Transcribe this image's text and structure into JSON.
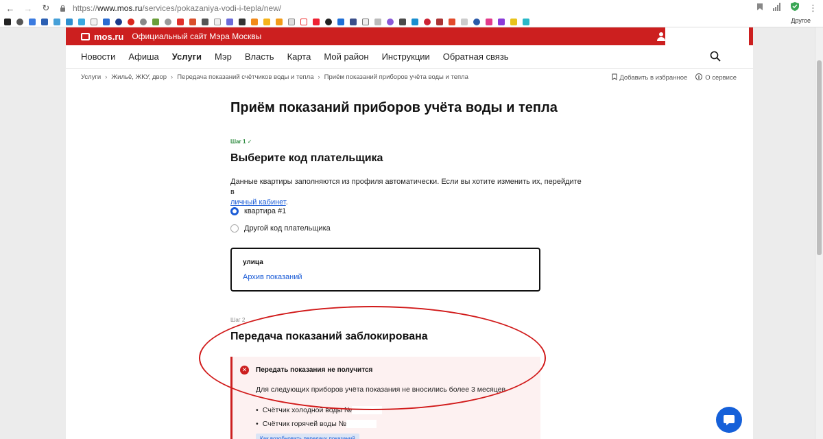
{
  "browser": {
    "url_prefix": "https://",
    "url_host": "www.mos.ru",
    "url_path": "/services/pokazaniya-vodi-i-tepla/new/",
    "bookmarks_other_label": "Другое"
  },
  "site": {
    "logo_text": "mos.ru",
    "header_title": "Официальный сайт Мэра Москвы",
    "nav": [
      {
        "label": "Новости"
      },
      {
        "label": "Афиша"
      },
      {
        "label": "Услуги",
        "active": true
      },
      {
        "label": "Мэр"
      },
      {
        "label": "Власть"
      },
      {
        "label": "Карта"
      },
      {
        "label": "Мой район"
      },
      {
        "label": "Инструкции"
      },
      {
        "label": "Обратная связь"
      }
    ],
    "breadcrumbs": [
      "Услуги",
      "Жильё, ЖКУ, двор",
      "Передача показаний счётчиков воды и тепла",
      "Приём показаний приборов учёта воды и тепла"
    ],
    "favorites_label": "Добавить в избранное",
    "about_label": "О сервисе"
  },
  "form": {
    "title": "Приём показаний приборов учёта воды и тепла",
    "step1_label": "Шаг 1",
    "step1_title": "Выберите код плательщика",
    "step1_desc": "Данные квартиры заполняются из профиля автоматически. Если вы хотите изменить их, перейдите в",
    "step1_link": "личный кабинет",
    "step1_desc_end": ".",
    "options": [
      {
        "label": "квартира #1",
        "selected": true
      },
      {
        "label": "Другой код плательщика",
        "selected": false
      }
    ],
    "address_street": "улица",
    "archive_link": "Архив показаний",
    "step2_label": "Шаг 2",
    "step2_title": "Передача показаний заблокирована",
    "alert_title": "Передать показания не получится",
    "alert_text": "Для следующих приборов учёта показания не вносились более 3 месяцев",
    "meters": [
      "Счётчик холодной воды №",
      "Счётчик горячей воды №"
    ],
    "resume_button": "Как возобновить передачу показаний"
  },
  "colors": {
    "brand_red": "#cc1f1f",
    "link_blue": "#1a5bd6",
    "success_green": "#2d8b3f",
    "annotation_red": "#d11a1a"
  }
}
